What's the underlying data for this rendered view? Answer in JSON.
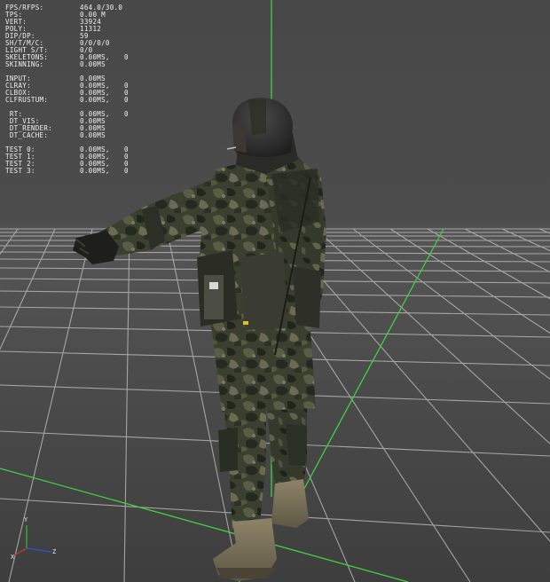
{
  "stats_overlay": {
    "group1": [
      {
        "label": "FPS/RFPS:",
        "value": "464.0/30.0",
        "extra": ""
      },
      {
        "label": "TPS:",
        "value": "0.00 M",
        "extra": ""
      },
      {
        "label": "VERT:",
        "value": "33924",
        "extra": ""
      },
      {
        "label": "POLY:",
        "value": "11312",
        "extra": ""
      },
      {
        "label": "DIP/DP:",
        "value": "59",
        "extra": ""
      },
      {
        "label": "SH/T/M/C:",
        "value": "0/0/0/0",
        "extra": ""
      },
      {
        "label": "LIGHT S/T:",
        "value": "0/0",
        "extra": ""
      },
      {
        "label": "SKELETONS:",
        "value": "0.00MS,",
        "extra": "0"
      },
      {
        "label": "SKINNING:",
        "value": "0.00MS",
        "extra": ""
      }
    ],
    "group2": [
      {
        "label": "INPUT:",
        "value": "0.00MS",
        "extra": ""
      },
      {
        "label": "CLRAY:",
        "value": "0.00MS,",
        "extra": "0"
      },
      {
        "label": "CLBOX:",
        "value": "0.00MS,",
        "extra": "0"
      },
      {
        "label": "CLFRUSTUM:",
        "value": "0.00MS,",
        "extra": "0"
      }
    ],
    "group3": [
      {
        "label": " RT:",
        "value": "0.00MS,",
        "extra": "0"
      },
      {
        "label": " DT_VIS:",
        "value": "0.00MS",
        "extra": ""
      },
      {
        "label": " DT_RENDER:",
        "value": "0.00MS",
        "extra": ""
      },
      {
        "label": " DT_CACHE:",
        "value": "0.00MS",
        "extra": ""
      }
    ],
    "group4": [
      {
        "label": "TEST 0:",
        "value": "0.00MS,",
        "extra": "0"
      },
      {
        "label": "TEST 1:",
        "value": "0.00MS,",
        "extra": "0"
      },
      {
        "label": "TEST 2:",
        "value": "0.00MS,",
        "extra": "0"
      },
      {
        "label": "TEST 3:",
        "value": "0.00MS,",
        "extra": "0"
      }
    ]
  },
  "axis_gizmo": {
    "y_label": "Y",
    "x_label": "X",
    "z_label": "Z"
  },
  "colors": {
    "background": "#4a4a4a",
    "grid_line": "#b5b5b5",
    "axis_green": "#3fd13f",
    "gizmo_red": "#d03030",
    "gizmo_blue": "#3050d0",
    "gizmo_green": "#30c030",
    "overlay_text": "#f0f0f0",
    "camo_base": "#3a3d2e"
  },
  "model": {
    "description_icon": "soldier-model"
  }
}
